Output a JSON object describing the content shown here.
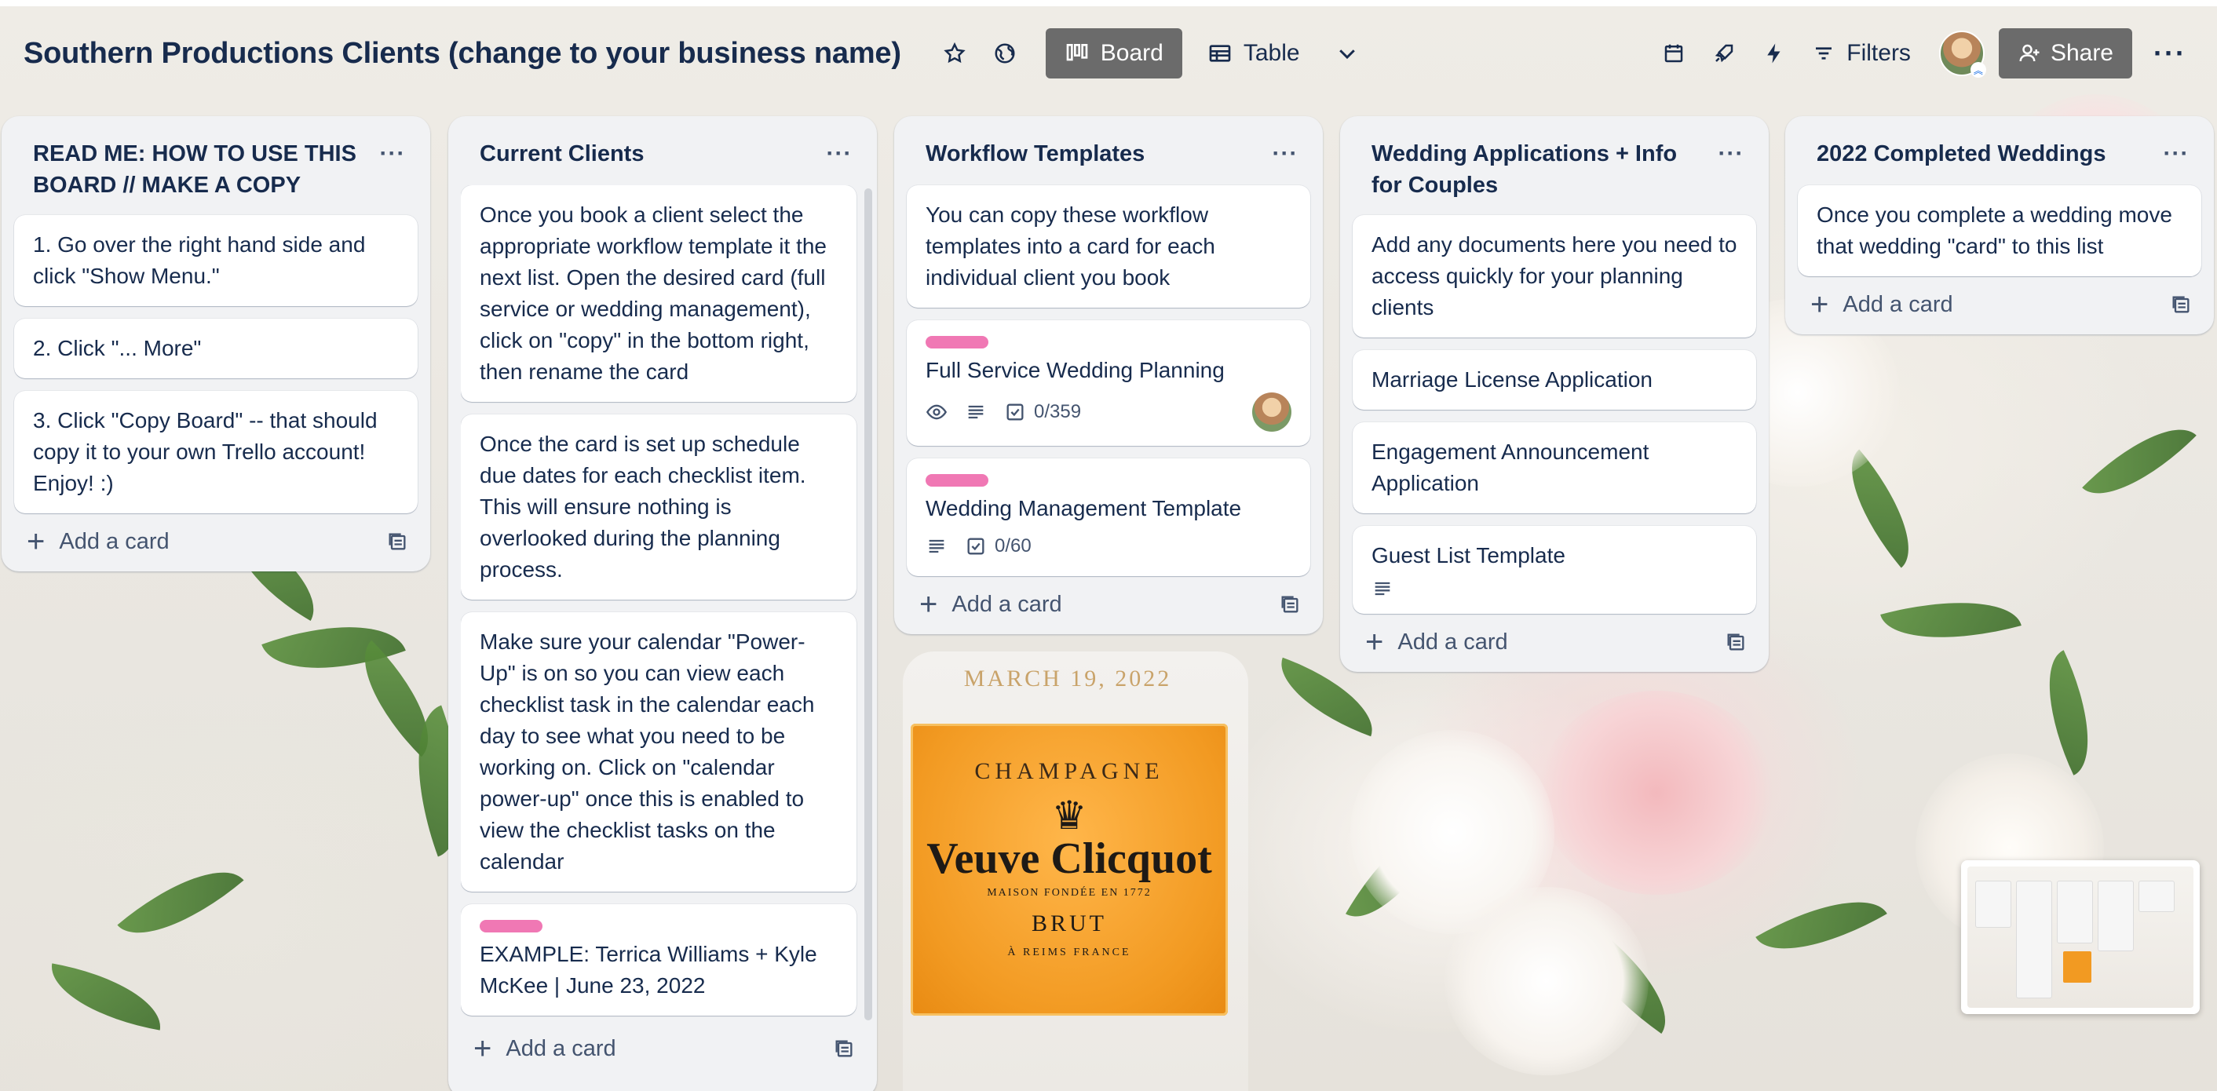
{
  "board": {
    "title": "Southern Productions Clients (change to your business name)",
    "views": [
      {
        "label": "Board",
        "active": true,
        "icon": "board-icon"
      },
      {
        "label": "Table",
        "active": false,
        "icon": "table-icon"
      }
    ],
    "filters_label": "Filters",
    "share_label": "Share"
  },
  "lists": [
    {
      "title": "READ ME: HOW TO USE THIS BOARD // MAKE A COPY",
      "cards": [
        {
          "text": "1. Go over the right hand side and click \"Show Menu.\""
        },
        {
          "text": "2. Click \"... More\""
        },
        {
          "text": "3. Click \"Copy Board\" -- that should copy it to your own Trello account! Enjoy! :)"
        }
      ],
      "add_card_label": "Add a card"
    },
    {
      "title": "Current Clients",
      "cards": [
        {
          "text": "Once you book a client select the appropriate workflow template it the next list. Open the desired card (full service or wedding management), click on \"copy\" in the bottom right, then rename the card"
        },
        {
          "text": "Once the card is set up schedule due dates for each checklist item. This will ensure nothing is overlooked during the planning process."
        },
        {
          "text": "Make sure your calendar \"Power-Up\" is on so you can view each checklist task in the calendar each day to see what you need to be working on. Click on \"calendar power-up\" once this is enabled to view the checklist tasks on the calendar"
        },
        {
          "text": "EXAMPLE: Terrica Williams + Kyle McKee | June 23, 2022",
          "label_color": "#f078b4"
        }
      ],
      "add_card_label": "Add a card"
    },
    {
      "title": "Workflow Templates",
      "cards": [
        {
          "text": "You can copy these workflow templates into a card for each individual client you book"
        },
        {
          "text": "Full Service Wedding Planning",
          "label_color": "#f078b4",
          "checklist": "0/359"
        },
        {
          "text": "Wedding Management Template",
          "label_color": "#f078b4",
          "checklist": "0/60"
        }
      ],
      "add_card_label": "Add a card"
    },
    {
      "title": "Wedding Applications + Info for Couples",
      "cards": [
        {
          "text": "Add any documents here you need to access quickly for your planning clients"
        },
        {
          "text": "Marriage License Application"
        },
        {
          "text": "Engagement Announcement Application"
        },
        {
          "text": "Guest List Template"
        }
      ],
      "add_card_label": "Add a card"
    },
    {
      "title": "2022 Completed Weddings",
      "cards": [
        {
          "text": "Once you complete a wedding move that wedding \"card\" to this list"
        }
      ],
      "add_card_label": "Add a card"
    }
  ],
  "background_text": {
    "date": "MARCH 19, 2022",
    "champagne": "CHAMPAGNE",
    "brand": "Veuve Clicquot",
    "maison": "MAISON FONDÉE EN 1772",
    "brut": "BRUT",
    "reims": "À REIMS FRANCE"
  },
  "colors": {
    "list_bg": "#f1f2f4",
    "label_pink": "#f078b4",
    "active_view_bg": "#6b6b6b",
    "text": "#172b4d"
  }
}
